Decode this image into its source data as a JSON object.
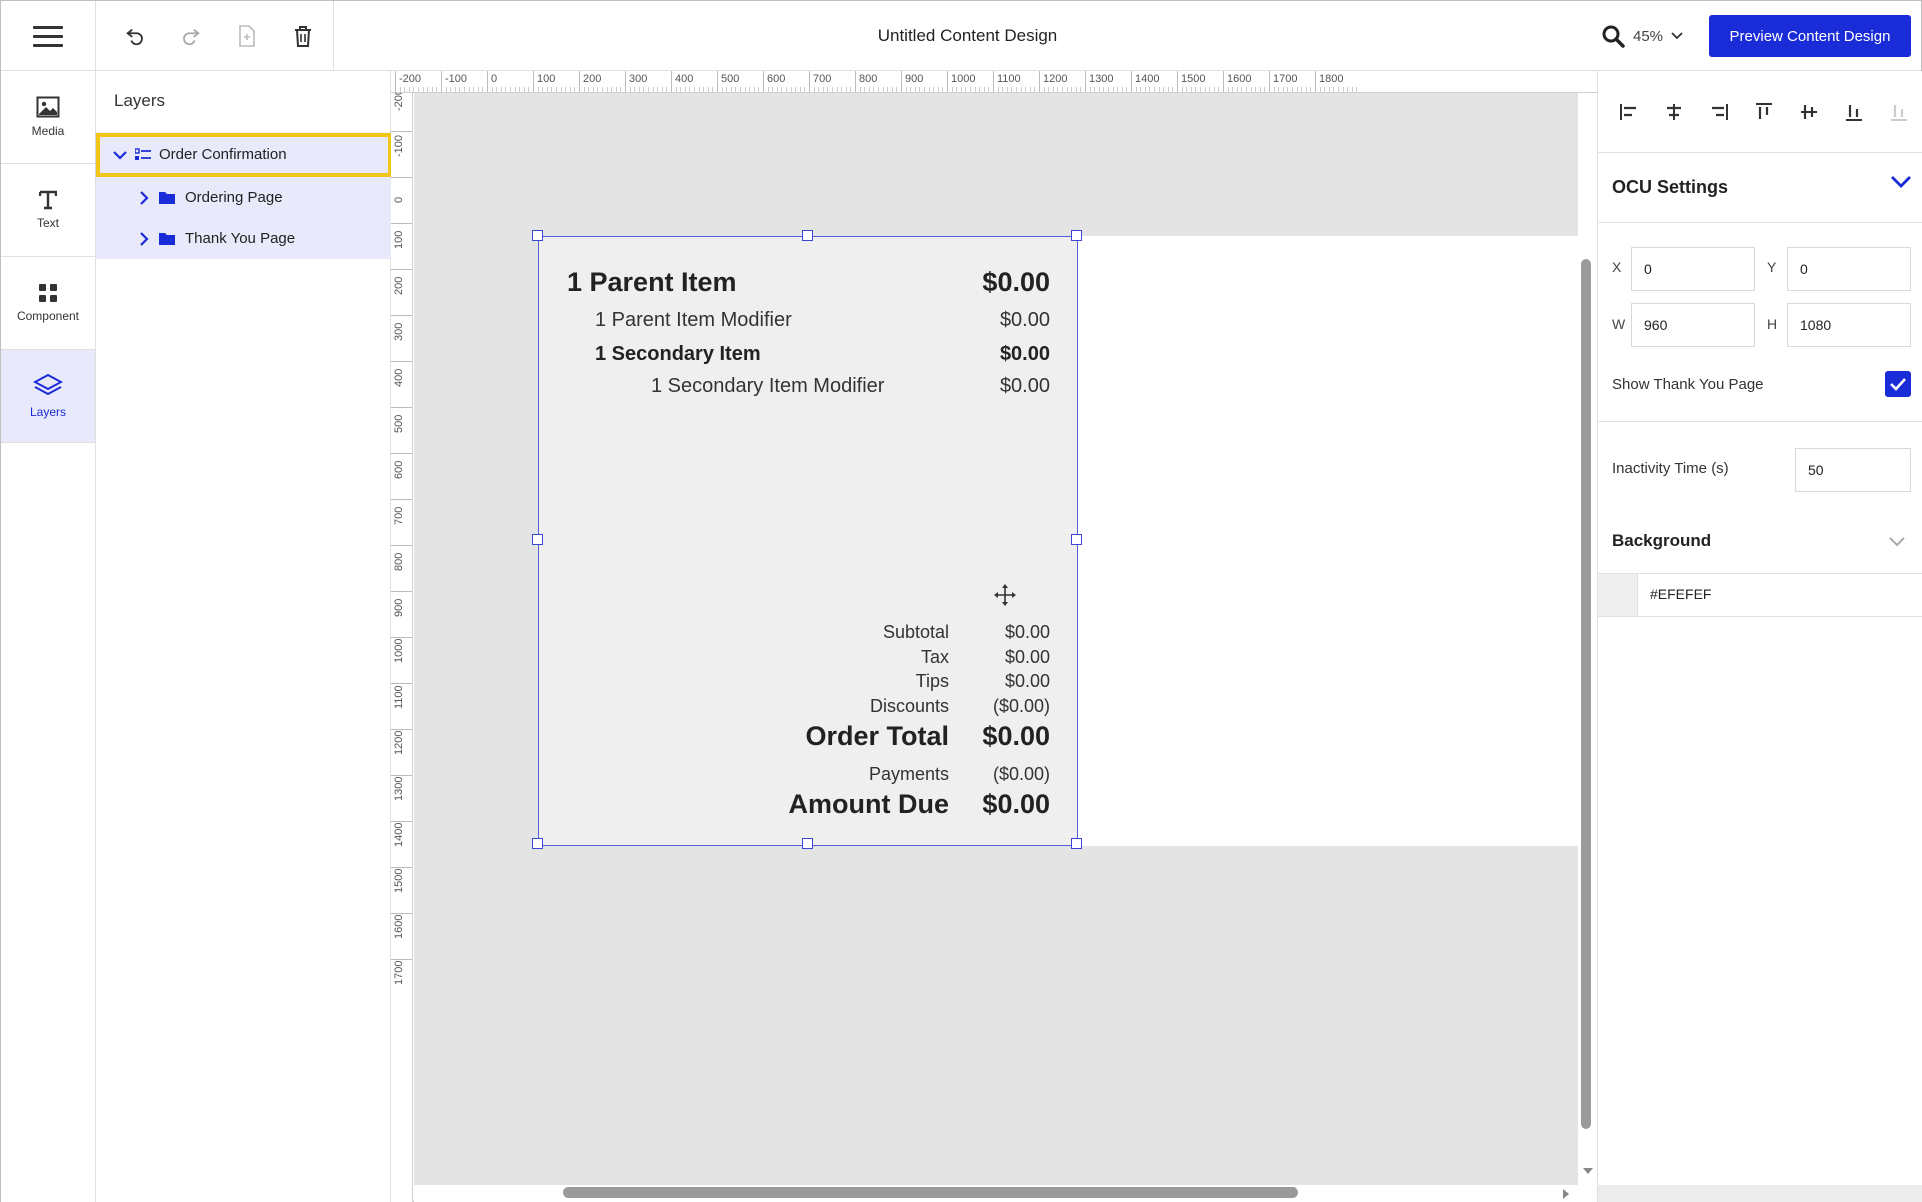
{
  "header": {
    "title": "Untitled Content Design",
    "zoom": "45%",
    "preview_label": "Preview Content Design"
  },
  "rail": {
    "items": [
      {
        "label": "Media",
        "icon": "image-icon"
      },
      {
        "label": "Text",
        "icon": "text-icon"
      },
      {
        "label": "Component",
        "icon": "grid-icon"
      },
      {
        "label": "Layers",
        "icon": "layers-icon"
      }
    ],
    "active": "Layers"
  },
  "layers": {
    "title": "Layers",
    "items": [
      {
        "label": "Order Confirmation",
        "expanded": true,
        "selected": true
      },
      {
        "label": "Ordering Page",
        "expanded": false
      },
      {
        "label": "Thank You Page",
        "expanded": false
      }
    ]
  },
  "rulers": {
    "horizontal": [
      "-200",
      "-100",
      "0",
      "100",
      "200",
      "300",
      "400",
      "500",
      "600",
      "700",
      "800",
      "900",
      "1000",
      "1100",
      "1200",
      "1300",
      "1400",
      "1500",
      "1600",
      "1700",
      "1800"
    ],
    "vertical": [
      "-200",
      "-100",
      "0",
      "100",
      "200",
      "300",
      "400",
      "500",
      "600",
      "700",
      "800",
      "900",
      "1000",
      "1100",
      "1200",
      "1300",
      "1400",
      "1500",
      "1600",
      "1700"
    ]
  },
  "receipt": {
    "parent_item": {
      "label": "1 Parent Item",
      "price": "$0.00"
    },
    "parent_modifier": {
      "label": "1 Parent Item Modifier",
      "price": "$0.00"
    },
    "secondary_item": {
      "label": "1 Secondary Item",
      "price": "$0.00"
    },
    "secondary_modifier": {
      "label": "1 Secondary Item Modifier",
      "price": "$0.00"
    },
    "subtotal": {
      "label": "Subtotal",
      "value": "$0.00"
    },
    "tax": {
      "label": "Tax",
      "value": "$0.00"
    },
    "tips": {
      "label": "Tips",
      "value": "$0.00"
    },
    "discounts": {
      "label": "Discounts",
      "value": "($0.00)"
    },
    "order_total": {
      "label": "Order Total",
      "value": "$0.00"
    },
    "payments": {
      "label": "Payments",
      "value": "($0.00)"
    },
    "amount_due": {
      "label": "Amount Due",
      "value": "$0.00"
    }
  },
  "settings": {
    "title": "OCU Settings",
    "x_label": "X",
    "x_value": "0",
    "y_label": "Y",
    "y_value": "0",
    "w_label": "W",
    "w_value": "960",
    "h_label": "H",
    "h_value": "1080",
    "show_thank_you_label": "Show Thank You Page",
    "show_thank_you_checked": true,
    "inactivity_label": "Inactivity Time (s)",
    "inactivity_value": "50",
    "background_title": "Background",
    "background_value": "#EFEFEF"
  },
  "colors": {
    "accent": "#1a2bd8",
    "highlight": "#f2c617",
    "canvas": "#e4e4e4",
    "receipt_bg": "#EFEFEF"
  }
}
